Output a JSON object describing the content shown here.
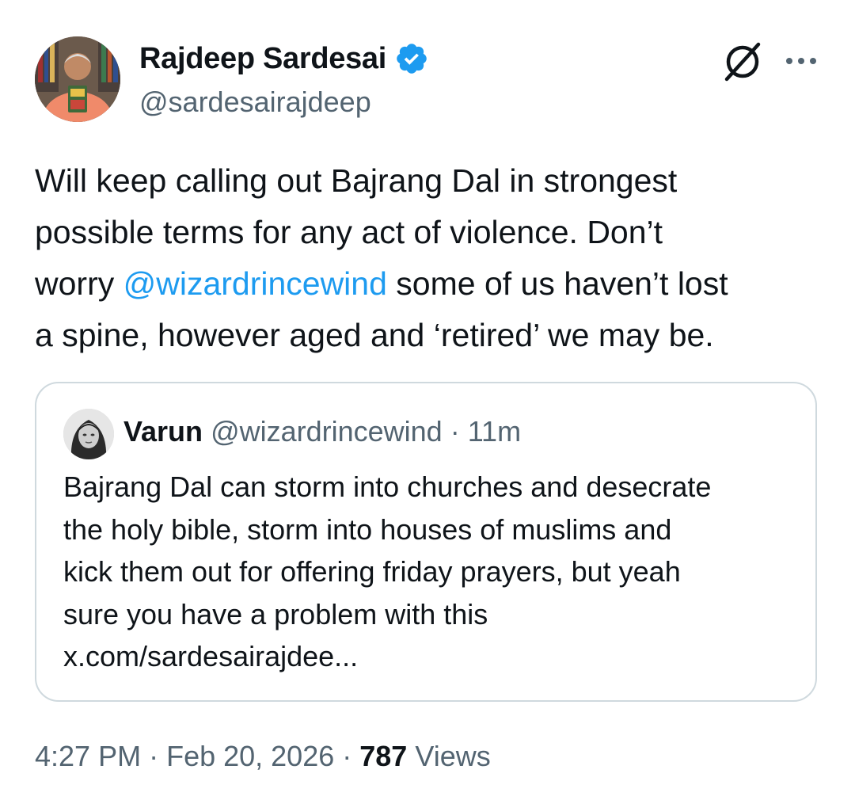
{
  "author": {
    "display_name": "Rajdeep Sardesai",
    "handle": "@sardesairajdeep",
    "verified": true
  },
  "tweet": {
    "text_part1": "Will keep calling out Bajrang Dal in strongest\npossible terms for any act of violence. Don’t\nworry ",
    "mention": "@wizardrincewind",
    "text_part2": " some of us haven’t lost\na spine, however aged and ‘retired’ we may be."
  },
  "quoted_tweet": {
    "display_name": "Varun",
    "handle": "@wizardrincewind",
    "separator": " · ",
    "time": "11m",
    "text": "Bajrang Dal can storm into churches and desecrate\nthe holy bible, storm into houses of muslims and\nkick them out for offering friday prayers, but yeah\nsure you have a problem with this\nx.com/sardesairajdee..."
  },
  "footer": {
    "time": "4:27 PM",
    "separator1": " · ",
    "date": "Feb 20, 2026",
    "separator2": " · ",
    "views_count": "787",
    "views_label": " Views"
  },
  "icons": {
    "verified": "verified-badge-icon",
    "grok": "grok-icon",
    "more": "more-options-icon"
  },
  "colors": {
    "link": "#1d9bf0",
    "secondary_text": "#536471",
    "primary_text": "#0f1419",
    "border": "#cfd9de",
    "verified": "#1d9bf0"
  }
}
